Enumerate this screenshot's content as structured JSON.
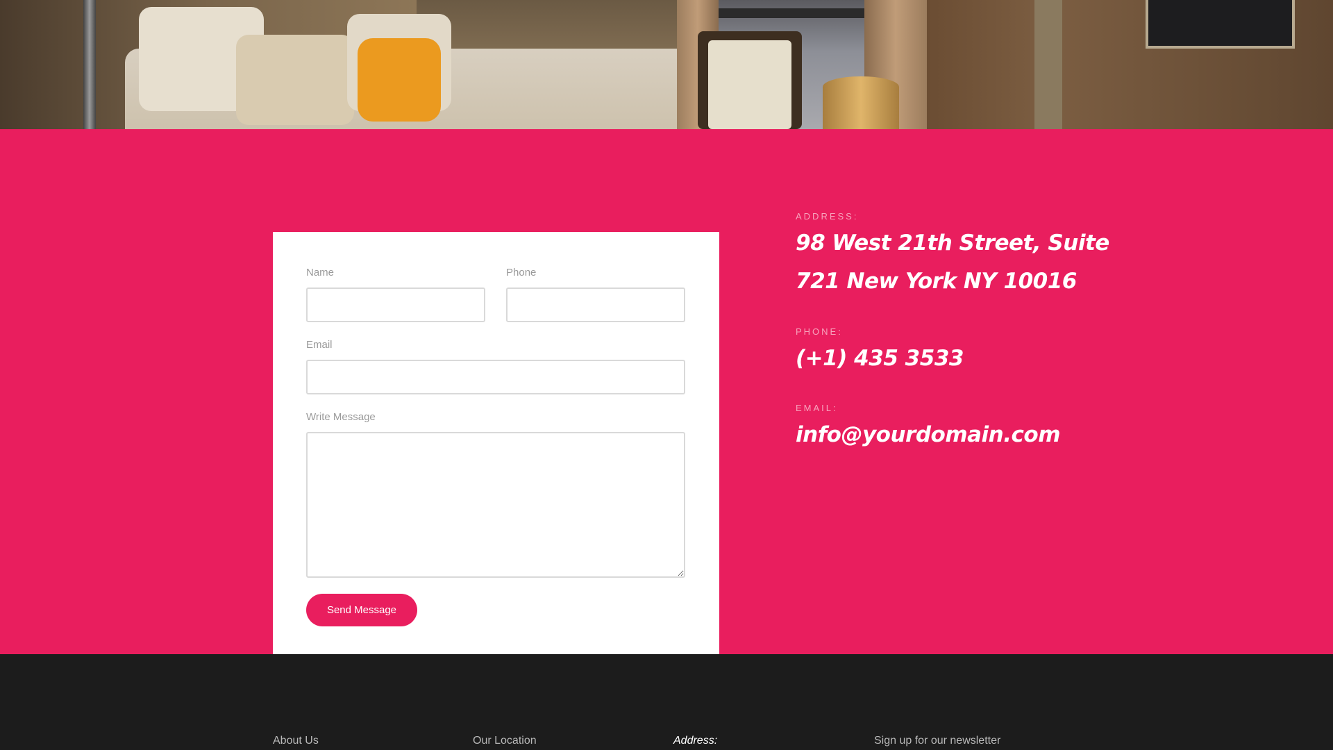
{
  "form": {
    "name_label": "Name",
    "name_value": "",
    "phone_label": "Phone",
    "phone_value": "",
    "email_label": "Email",
    "email_value": "",
    "message_label": "Write Message",
    "message_value": "",
    "submit_label": "Send Message"
  },
  "contact": {
    "address_label": "ADDRESS:",
    "address_line1": "98 West 21th Street, Suite",
    "address_line2": "721 New York NY 10016",
    "phone_label": "PHONE:",
    "phone_value": "(+1) 435 3533",
    "email_label": "EMAIL:",
    "email_value": "info@yourdomain.com"
  },
  "footer": {
    "headings": [
      "About Us",
      "Our Location",
      "Address:",
      "Sign up for our newsletter"
    ]
  },
  "colors": {
    "accent": "#e91e5e",
    "footer_bg": "#1c1c1c",
    "card_bg": "#ffffff"
  }
}
